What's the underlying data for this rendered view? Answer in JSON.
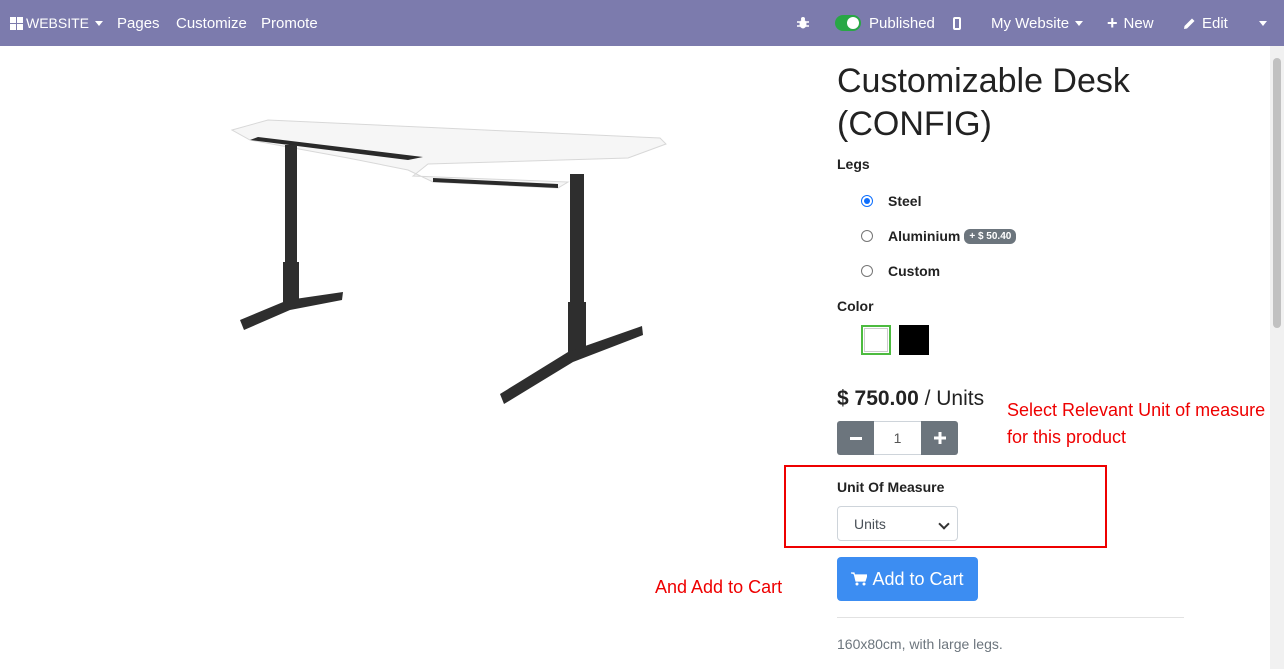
{
  "topbar": {
    "website_label": "WEBSITE",
    "pages": "Pages",
    "customize": "Customize",
    "promote": "Promote",
    "published": "Published",
    "my_website": "My Website",
    "new": "New",
    "edit": "Edit"
  },
  "product": {
    "title": "Customizable Desk (CONFIG)",
    "legs_label": "Legs",
    "legs_options": [
      {
        "label": "Steel",
        "selected": true
      },
      {
        "label": "Aluminium",
        "extra": "+ $ 50.40",
        "selected": false
      },
      {
        "label": "Custom",
        "selected": false
      }
    ],
    "color_label": "Color",
    "colors": [
      "#ffffff",
      "#000000"
    ],
    "price": "$ 750.00",
    "price_unit": "/ Units",
    "quantity": "1",
    "uom_label": "Unit Of Measure",
    "uom_value": "Units",
    "add_to_cart": "Add to Cart",
    "description": "160x80cm, with large legs."
  },
  "annotations": {
    "select_uom": "Select Relevant Unit of measure for this product",
    "add_to_cart": "And Add to Cart"
  },
  "colors": {
    "topbar": "#7c7bad",
    "primary": "#3c8df2",
    "annotation": "#ee0000"
  }
}
